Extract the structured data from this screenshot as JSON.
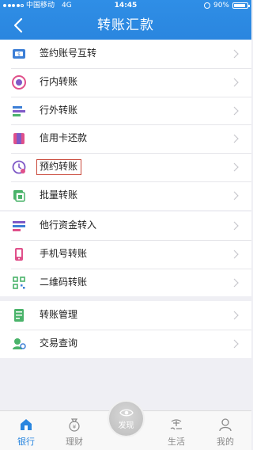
{
  "status_bar": {
    "carrier": "中国移动",
    "network": "4G",
    "time": "14:45",
    "battery": "90%",
    "battery_level": 0.9
  },
  "header": {
    "title": "转账汇款"
  },
  "groups": [
    {
      "items": [
        {
          "label": "签约账号互转",
          "icon": "account-transfer-icon"
        },
        {
          "label": "行内转账",
          "icon": "bank-transfer-icon"
        },
        {
          "label": "行外转账",
          "icon": "external-transfer-icon"
        },
        {
          "label": "信用卡还款",
          "icon": "credit-card-icon"
        },
        {
          "label": "预约转账",
          "icon": "clock-icon",
          "highlighted": true
        },
        {
          "label": "批量转账",
          "icon": "batch-transfer-icon"
        }
      ]
    },
    {
      "items": [
        {
          "label": "他行资金转入",
          "icon": "fund-in-icon"
        },
        {
          "label": "手机号转账",
          "icon": "phone-icon"
        },
        {
          "label": "二维码转账",
          "icon": "qrcode-icon"
        }
      ]
    },
    {
      "items": [
        {
          "label": "转账管理",
          "icon": "manage-icon"
        },
        {
          "label": "交易查询",
          "icon": "query-icon"
        }
      ]
    }
  ],
  "tabbar": {
    "tabs": [
      {
        "label": "银行",
        "icon": "home-icon",
        "active": true
      },
      {
        "label": "理财",
        "icon": "moneybag-icon"
      },
      {
        "label": "发现",
        "icon": "eye-icon"
      },
      {
        "label": "生活",
        "icon": "life-icon"
      },
      {
        "label": "我的",
        "icon": "user-icon"
      }
    ]
  },
  "colors": {
    "primary": "#2a86df",
    "background": "#efeff4",
    "highlight_border": "#c9483a",
    "icon_blue": "#3d7fd6",
    "icon_pink": "#e0508a",
    "icon_purple": "#7f5ac7",
    "icon_green": "#4ab36a"
  }
}
